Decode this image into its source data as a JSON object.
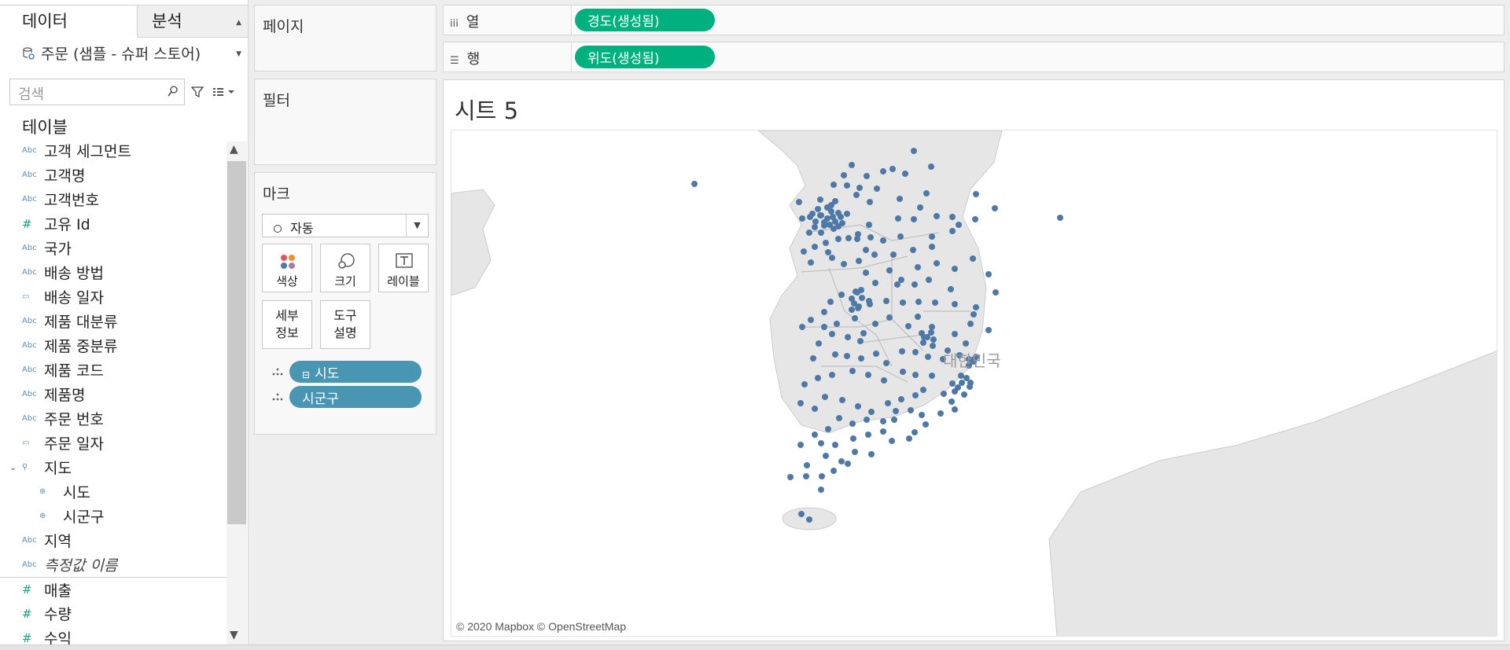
{
  "data_pane": {
    "tab_data": "데이터",
    "tab_analysis": "분석",
    "datasource": "주문 (샘플 - 슈퍼 스토어)",
    "search_placeholder": "검색",
    "tables_title": "테이블",
    "fields": [
      {
        "type": "Abc",
        "label": "고객 세그먼트"
      },
      {
        "type": "Abc",
        "label": "고객명"
      },
      {
        "type": "Abc",
        "label": "고객번호"
      },
      {
        "type": "#",
        "label": "고유 Id"
      },
      {
        "type": "Abc",
        "label": "국가"
      },
      {
        "type": "Abc",
        "label": "배송 방법"
      },
      {
        "type": "date",
        "label": "배송 일자"
      },
      {
        "type": "Abc",
        "label": "제품 대분류"
      },
      {
        "type": "Abc",
        "label": "제품 중분류"
      },
      {
        "type": "Abc",
        "label": "제품 코드"
      },
      {
        "type": "Abc",
        "label": "제품명"
      },
      {
        "type": "Abc",
        "label": "주문 번호"
      },
      {
        "type": "date",
        "label": "주문 일자"
      },
      {
        "type": "hierarchy",
        "label": "지도"
      },
      {
        "type": "geo",
        "label": "시도"
      },
      {
        "type": "geo",
        "label": "시군구"
      },
      {
        "type": "Abc",
        "label": "지역"
      },
      {
        "type": "Abc",
        "label": "측정값 이름"
      },
      {
        "type": "#",
        "label": "매출"
      },
      {
        "type": "#",
        "label": "수량"
      },
      {
        "type": "#",
        "label": "수익"
      }
    ]
  },
  "cards": {
    "pages": "페이지",
    "filters": "필터",
    "marks": "마크",
    "mark_type": "자동",
    "buttons": {
      "color": "색상",
      "size": "크기",
      "label": "레이블",
      "detail_1": "세부",
      "detail_2": "정보",
      "tooltip_1": "도구",
      "tooltip_2": "설명"
    },
    "pills": [
      "시도",
      "시군구"
    ]
  },
  "shelves": {
    "columns_label": "열",
    "columns_pill": "경도(생성됨)",
    "rows_label": "행",
    "rows_pill": "위도(생성됨)"
  },
  "view": {
    "sheet_title": "시트 5",
    "country_label": "대한민국",
    "attribution": "© 2020 Mapbox © OpenStreetMap",
    "mark_color": "#4e79a7"
  }
}
